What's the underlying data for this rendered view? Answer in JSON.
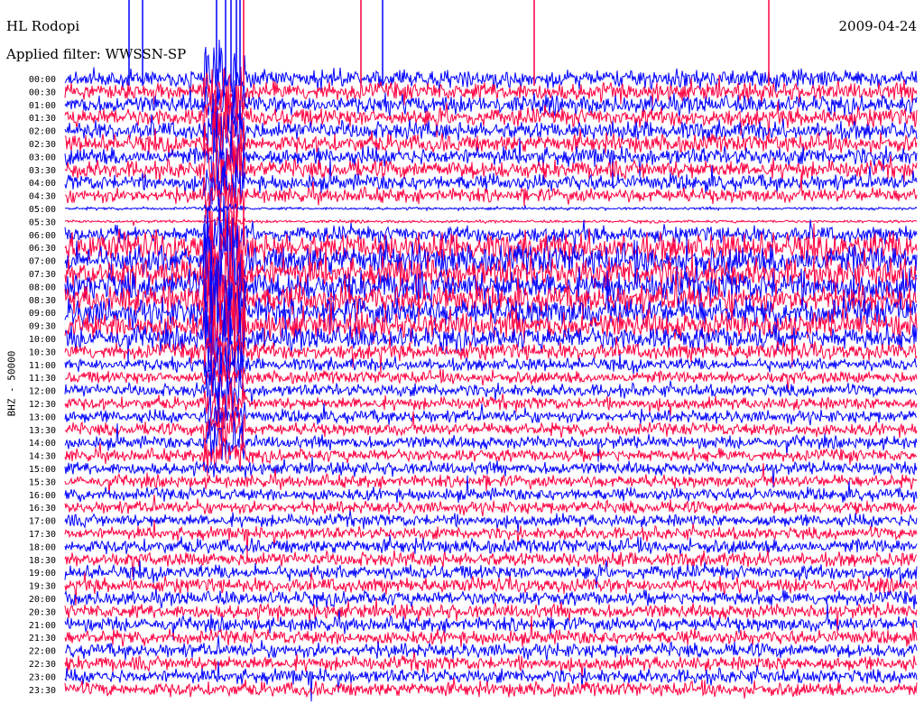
{
  "header": {
    "station": "HL Rodopi",
    "date": "2009-04-24",
    "filter_label": "Applied filter: WWSSN-SP"
  },
  "chart_data": {
    "type": "line",
    "title": "HL Rodopi",
    "date": "2009-04-24",
    "filter": "WWSSN-SP",
    "ylabel": "BHZ - 50000",
    "colors": {
      "odd": "#0000ff",
      "even": "#ff0040"
    },
    "row_labels": [
      "00:00",
      "00:30",
      "01:00",
      "01:30",
      "02:00",
      "02:30",
      "03:00",
      "03:30",
      "04:00",
      "04:30",
      "05:00",
      "05:30",
      "06:00",
      "06:30",
      "07:00",
      "07:30",
      "08:00",
      "08:30",
      "09:00",
      "09:30",
      "10:00",
      "10:30",
      "11:00",
      "11:30",
      "12:00",
      "12:30",
      "13:00",
      "13:30",
      "14:00",
      "14:30",
      "15:00",
      "15:30",
      "16:00",
      "16:30",
      "17:00",
      "17:30",
      "18:00",
      "18:30",
      "19:00",
      "19:30",
      "20:00",
      "20:30",
      "21:00",
      "21:30",
      "22:00",
      "22:30",
      "23:00",
      "23:30"
    ],
    "row_amplitude": [
      1.0,
      1.0,
      1.0,
      1.0,
      1.0,
      1.0,
      1.0,
      1.0,
      0.9,
      0.8,
      0.15,
      0.15,
      0.9,
      1.6,
      1.7,
      1.7,
      1.7,
      1.6,
      1.6,
      1.5,
      1.3,
      0.9,
      0.7,
      0.7,
      0.7,
      0.7,
      0.7,
      0.7,
      0.7,
      0.7,
      0.7,
      0.7,
      0.7,
      0.7,
      0.7,
      0.7,
      0.8,
      0.8,
      0.8,
      0.8,
      0.8,
      0.8,
      0.8,
      0.8,
      0.8,
      0.8,
      0.8,
      0.8
    ],
    "grid": false,
    "legend": "none"
  }
}
